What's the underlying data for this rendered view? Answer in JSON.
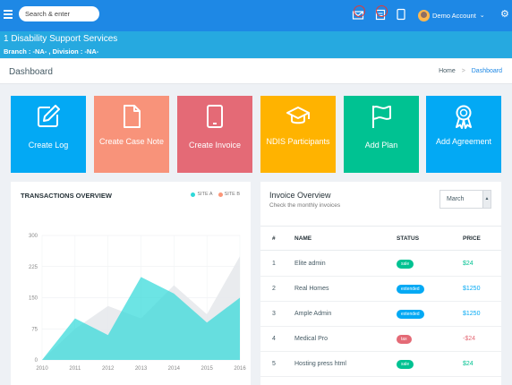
{
  "topbar": {
    "search_placeholder": "Search & enter",
    "account_name": "Demo Account",
    "chevron": "⌄",
    "gear": "⚙"
  },
  "org": {
    "name": "1 Disability Support Services",
    "branch_line": "Branch : -NA- , Division : -NA-"
  },
  "page": {
    "title": "Dashboard",
    "breadcrumb": {
      "home": "Home",
      "separator": ">",
      "current": "Dashboard"
    }
  },
  "tiles": [
    {
      "label": "Create Log",
      "icon": "edit-icon",
      "color": "#03a9f4"
    },
    {
      "label": "Create Case Note",
      "icon": "document-icon",
      "color": "#f8937a"
    },
    {
      "label": "Create Invoice",
      "icon": "tablet-icon",
      "color": "#e46a76"
    },
    {
      "label": "NDIS Participants",
      "icon": "graduation-cap-icon",
      "color": "#ffb300"
    },
    {
      "label": "Add Plan",
      "icon": "flag-icon",
      "color": "#00c292"
    },
    {
      "label": "Add Agreement",
      "icon": "award-icon",
      "color": "#03a9f4"
    }
  ],
  "transactions": {
    "title": "TRANSACTIONS OVERVIEW",
    "legend": [
      {
        "name": "SITE A",
        "color": "#2ed8d8"
      },
      {
        "name": "SITE B",
        "color": "#fb9678"
      }
    ]
  },
  "chart_data": {
    "type": "area",
    "title": "TRANSACTIONS OVERVIEW",
    "x": [
      "2010",
      "2011",
      "2012",
      "2013",
      "2014",
      "2015",
      "2016"
    ],
    "ylim": [
      0,
      300
    ],
    "yticks": [
      "0",
      "75",
      "150",
      "225",
      "300"
    ],
    "grid": true,
    "legend_position": "top-right",
    "series": [
      {
        "name": "SITE A",
        "color": "#2ed8d8",
        "values": [
          0,
          100,
          60,
          200,
          160,
          90,
          150
        ]
      },
      {
        "name": "SITE B",
        "color": "#e7e9ec",
        "values": [
          0,
          75,
          130,
          100,
          180,
          110,
          250
        ]
      }
    ]
  },
  "invoice": {
    "title": "Invoice Overview",
    "subtitle": "Check the monthly invoices",
    "month_selected": "March",
    "columns": [
      "#",
      "NAME",
      "STATUS",
      "PRICE"
    ],
    "rows": [
      {
        "num": "1",
        "name": "Elite admin",
        "status": "sale",
        "status_color": "#00c292",
        "price": "$24",
        "price_color": "#00c292"
      },
      {
        "num": "2",
        "name": "Real Homes",
        "status": "extended",
        "status_color": "#03a9f4",
        "price": "$1250",
        "price_color": "#03a9f4"
      },
      {
        "num": "3",
        "name": "Ample Admin",
        "status": "extended",
        "status_color": "#03a9f4",
        "price": "$1250",
        "price_color": "#03a9f4"
      },
      {
        "num": "4",
        "name": "Medical Pro",
        "status": "tax",
        "status_color": "#e46a76",
        "price": "-$24",
        "price_color": "#e46a76"
      },
      {
        "num": "5",
        "name": "Hosting press html",
        "status": "sale",
        "status_color": "#00c292",
        "price": "$24",
        "price_color": "#00c292"
      }
    ]
  }
}
